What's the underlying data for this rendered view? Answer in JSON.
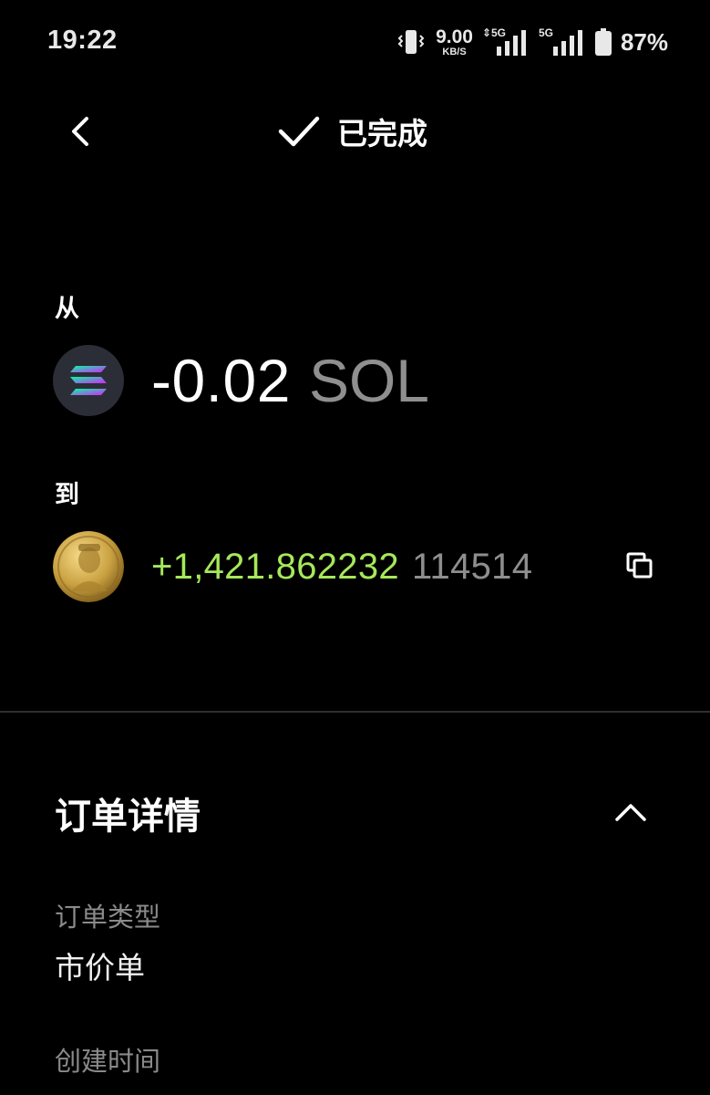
{
  "status_bar": {
    "time": "19:22",
    "net_speed_value": "9.00",
    "net_speed_unit": "KB/S",
    "signal1_tag": "⇕5G",
    "signal2_tag": "5G",
    "battery_percent": "87%"
  },
  "header": {
    "title": "已完成",
    "back_icon": "chevron-left-icon",
    "status_icon": "check-icon"
  },
  "from": {
    "label": "从",
    "amount": "-0.02",
    "symbol": "SOL",
    "icon": "solana-logo"
  },
  "to": {
    "label": "到",
    "amount": "+1,421.862232",
    "symbol": "114514",
    "icon": "token-coin-logo",
    "copy_icon": "copy-icon"
  },
  "order_details": {
    "title": "订单详情",
    "toggle_icon": "chevron-up-icon",
    "fields": [
      {
        "label": "订单类型",
        "value": "市价单"
      },
      {
        "label": "创建时间",
        "value": ""
      }
    ]
  },
  "colors": {
    "background": "#000000",
    "positive_amount": "#a6e85a",
    "muted_text": "#8a8a8a",
    "divider": "#2f2f2f"
  }
}
